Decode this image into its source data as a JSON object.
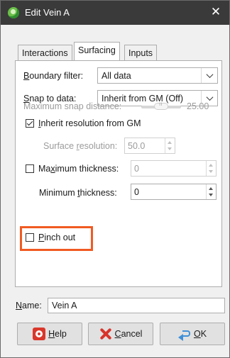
{
  "window": {
    "title": "Edit Vein A",
    "close_symbol": "✕"
  },
  "tabs": [
    {
      "label": "Interactions",
      "active": false
    },
    {
      "label": "Surfacing",
      "active": true
    },
    {
      "label": "Inputs",
      "active": false
    }
  ],
  "surfacing": {
    "boundary_filter": {
      "label_key": "B",
      "label_rest": "oundary filter:",
      "value": "All data"
    },
    "snap_to_data": {
      "label_key": "S",
      "label_rest": "nap to data:",
      "value": "Inherit from GM (Off)"
    },
    "max_snap_distance": {
      "label": "Maximum snap distance:",
      "value": "25.00",
      "enabled": false
    },
    "inherit_resolution": {
      "label_key": "I",
      "label_rest": "nherit resolution from GM",
      "checked": true
    },
    "surface_resolution": {
      "label_pre": "Surface ",
      "label_key": "r",
      "label_rest": "esolution:",
      "value": "50.0",
      "enabled": false
    },
    "maximum_thickness": {
      "label_pre": "Ma",
      "label_key": "x",
      "label_rest": "imum thickness:",
      "value": "0",
      "checked": false,
      "field_enabled": false
    },
    "minimum_thickness": {
      "label_pre": "Minimum ",
      "label_key": "t",
      "label_rest": "hickness:",
      "value": "0"
    },
    "pinch_out": {
      "label_key": "P",
      "label_rest": "inch out",
      "checked": false
    }
  },
  "name_field": {
    "label_key": "N",
    "label_rest": "ame:",
    "value": "Vein A"
  },
  "buttons": {
    "help": {
      "key": "H",
      "rest": "elp"
    },
    "cancel": {
      "key": "C",
      "rest": "ancel"
    },
    "ok": {
      "key": "O",
      "rest": "K"
    }
  },
  "colors": {
    "highlight": "#f15a22",
    "titlebar": "#3a3a3a"
  }
}
